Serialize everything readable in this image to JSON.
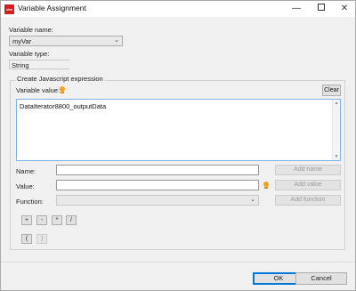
{
  "window": {
    "title": "Variable Assignment",
    "app_icon_text": "ubs"
  },
  "controls": {
    "minimize": "—",
    "close": "✕"
  },
  "variable_name": {
    "label": "Variable name:",
    "value": "myVar"
  },
  "variable_type": {
    "label": "Variable type:",
    "value": "String"
  },
  "group": {
    "title": "Create Javascript expression",
    "value_label": "Variable value:",
    "clear_label": "Clear",
    "expression": "DataIterator8800_outputData"
  },
  "name_row": {
    "label": "Name:",
    "value": "",
    "button": "Add name"
  },
  "value_row": {
    "label": "Value:",
    "value": "",
    "button": "Add value"
  },
  "function_row": {
    "label": "Function:",
    "value": "",
    "button": "Add function"
  },
  "operators": [
    "+",
    "-",
    "*",
    "/"
  ],
  "brackets": [
    "(",
    ")"
  ],
  "footer": {
    "ok": "OK",
    "cancel": "Cancel"
  },
  "colors": {
    "accent": "#0078d7",
    "bulb": "#f7a21b",
    "brand": "#d21f1f"
  }
}
